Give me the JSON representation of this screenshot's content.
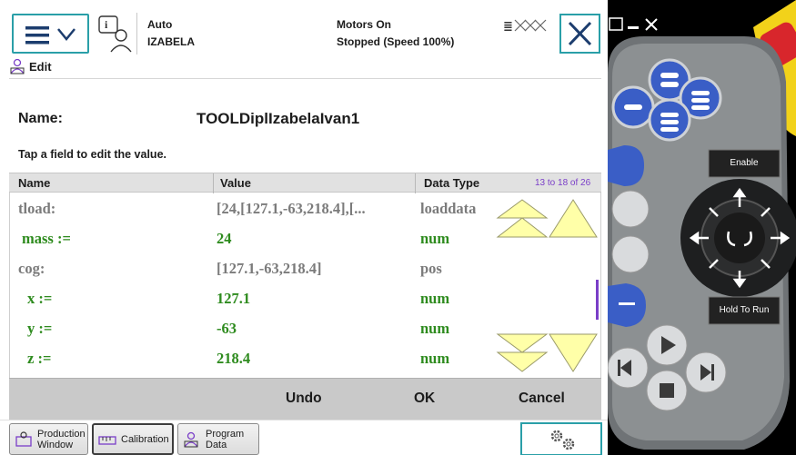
{
  "status": {
    "mode": "Auto",
    "system_name": "IZABELA",
    "motors": "Motors On",
    "run_state": "Stopped (Speed 100%)"
  },
  "edit_tab": {
    "label": "Edit"
  },
  "editor": {
    "name_label": "Name:",
    "name_value": "TOOLDiplIzabelaIvan1",
    "hint": "Tap a field to edit the value."
  },
  "table": {
    "columns": [
      "Name",
      "Value",
      "Data Type"
    ],
    "pager": "13 to 18 of 26",
    "rows": [
      {
        "name": "tload:",
        "value": "[24,[127.1,-63,218.4],[...",
        "type": "loaddata",
        "style": "grey"
      },
      {
        "name": "mass :=",
        "value": "24",
        "type": "num",
        "style": "green"
      },
      {
        "name": "cog:",
        "value": "[127.1,-63,218.4]",
        "type": "pos",
        "style": "grey"
      },
      {
        "name": "x :=",
        "value": "127.1",
        "type": "num",
        "style": "green"
      },
      {
        "name": "y :=",
        "value": "-63",
        "type": "num",
        "style": "green"
      },
      {
        "name": "z :=",
        "value": "218.4",
        "type": "num",
        "style": "green"
      }
    ]
  },
  "commands": {
    "undo": "Undo",
    "ok": "OK",
    "cancel": "Cancel"
  },
  "taskbar": {
    "items": [
      {
        "line1": "Production",
        "line2": "Window",
        "icon": "production-window-icon"
      },
      {
        "line1": "Calibration",
        "line2": "",
        "icon": "calibration-icon"
      },
      {
        "line1": "Program",
        "line2": "Data",
        "icon": "program-data-icon"
      }
    ]
  },
  "hardware": {
    "enable_label": "Enable",
    "hold_to_run_label": "Hold To Run"
  },
  "colors": {
    "accent_teal": "#2a9fa8",
    "value_green": "#2e8b1e",
    "value_grey": "#7b7b7b",
    "pager_purple": "#7a3ec8",
    "arrow_yellow": "#ffffa8",
    "emergency_red": "#d8262c"
  }
}
